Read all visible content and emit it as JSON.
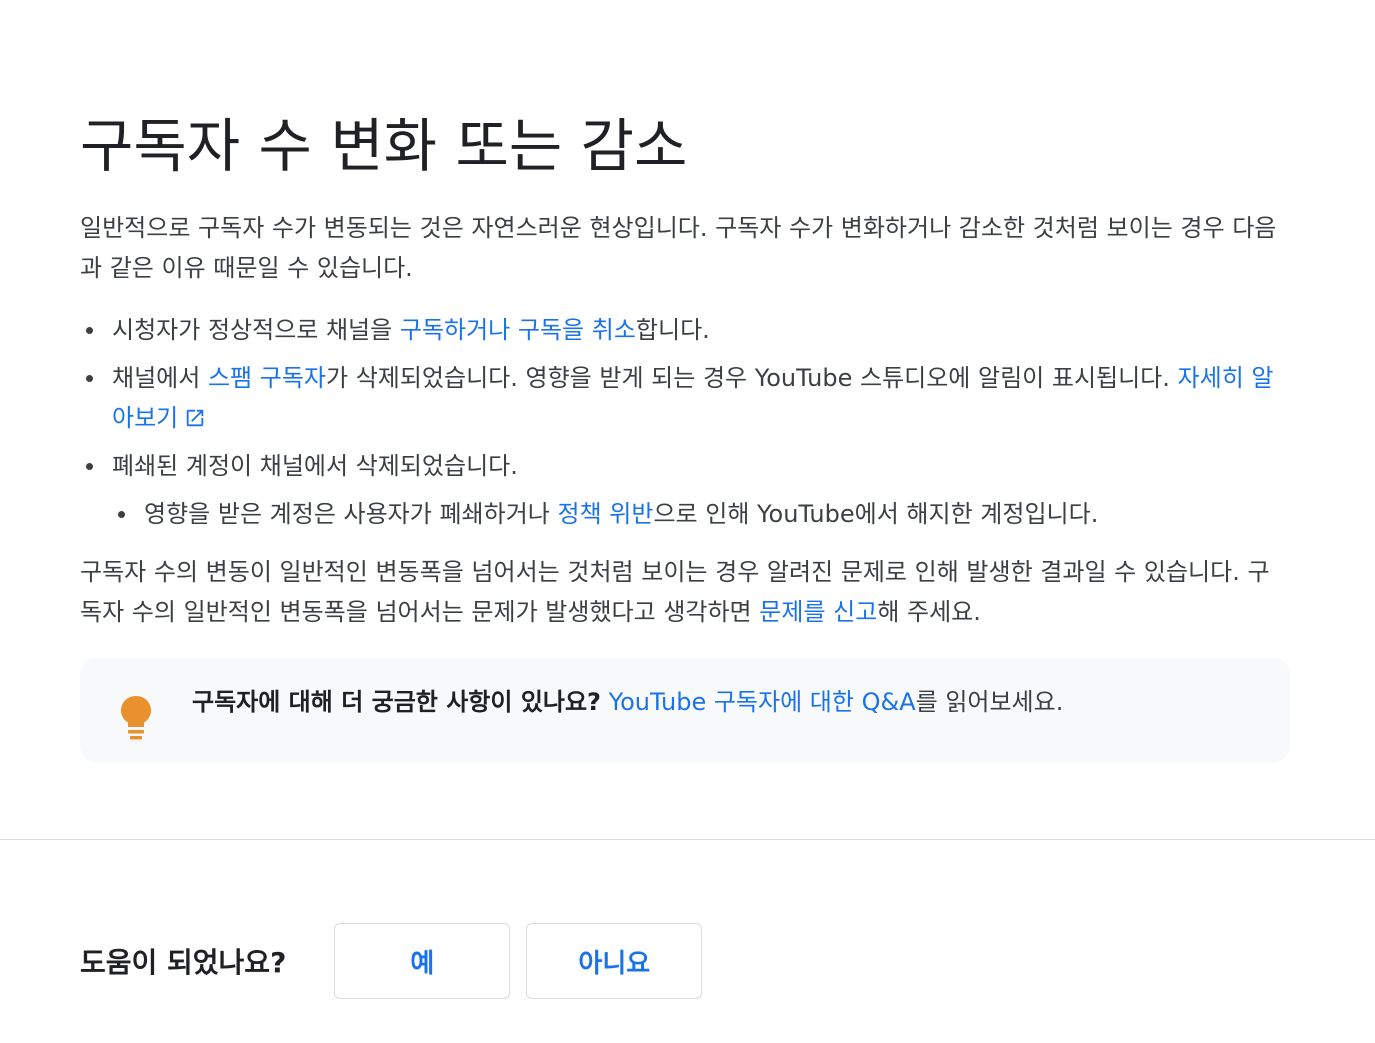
{
  "title": "구독자 수 변화 또는 감소",
  "intro": "일반적으로 구독자 수가 변동되는 것은 자연스러운 현상입니다. 구독자 수가 변화하거나 감소한 것처럼 보이는 경우 다음과 같은 이유 때문일 수 있습니다.",
  "bullets": {
    "b1": {
      "pre": "시청자가 정상적으로 채널을 ",
      "link1": "구독하거나 구독을 취소",
      "post": "합니다."
    },
    "b2": {
      "pre": "채널에서 ",
      "link1": "스팸 구독자",
      "mid": "가 삭제되었습니다. 영향을 받게 되는 경우 YouTube 스튜디오에 알림이 표시됩니다. ",
      "link2": "자세히 알아보기",
      "ext_icon": "external-link-icon"
    },
    "b3": {
      "text": "폐쇄된 계정이 채널에서 삭제되었습니다.",
      "sub": {
        "pre": "영향을 받은 계정은 사용자가 폐쇄하거나 ",
        "link1": "정책 위반",
        "post": "으로 인해 YouTube에서 해지한 계정입니다."
      }
    }
  },
  "outro": {
    "pre": "구독자 수의 변동이 일반적인 변동폭을 넘어서는 것처럼 보이는 경우 알려진 문제로 인해 발생한 결과일 수 있습니다. 구독자 수의 일반적인 변동폭을 넘어서는 문제가 발생했다고 생각하면 ",
    "link1": "문제를 신고",
    "post": "해 주세요."
  },
  "callout": {
    "icon": "lightbulb-icon",
    "bold": "구독자에 대해 더 궁금한 사항이 있나요?",
    "link1": "YouTube 구독자에 대한 Q&A",
    "post": "를 읽어보세요."
  },
  "feedback": {
    "question": "도움이 되었나요?",
    "yes_label": "예",
    "no_label": "아니요"
  },
  "colors": {
    "link": "#1a73e8",
    "text": "#3c4043",
    "heading": "#202124",
    "callout_bg": "#f8f9fa",
    "bulb": "#e8912d",
    "divider": "#dadce0"
  }
}
